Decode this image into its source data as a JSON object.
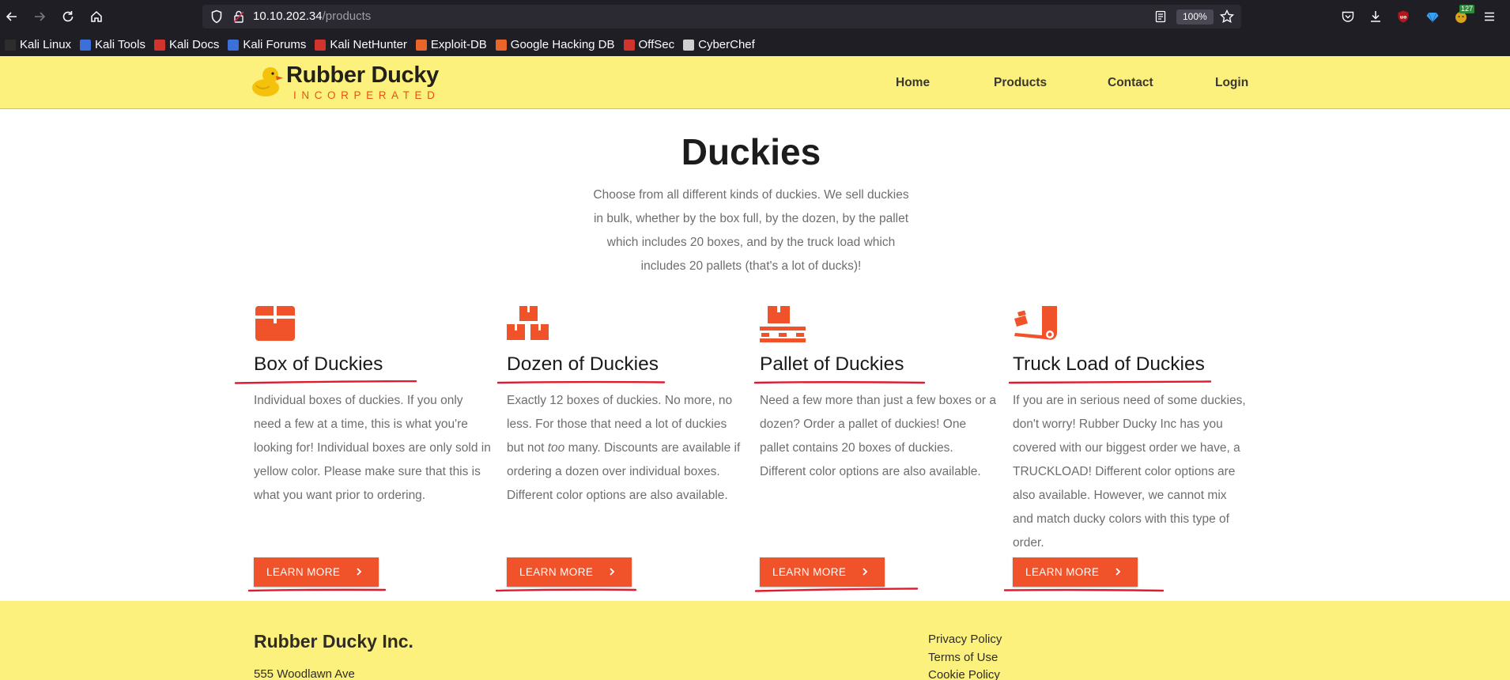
{
  "browser": {
    "url_host": "10.10.202.34",
    "url_path": "/products",
    "zoom": "100%",
    "extension_badge": "127",
    "bookmarks": [
      {
        "label": "Kali Linux",
        "color": "#2d2d2d"
      },
      {
        "label": "Kali Tools",
        "color": "#3b6fd9"
      },
      {
        "label": "Kali Docs",
        "color": "#d0342c"
      },
      {
        "label": "Kali Forums",
        "color": "#3b6fd9"
      },
      {
        "label": "Kali NetHunter",
        "color": "#d0342c"
      },
      {
        "label": "Exploit-DB",
        "color": "#e8662a"
      },
      {
        "label": "Google Hacking DB",
        "color": "#e8662a"
      },
      {
        "label": "OffSec",
        "color": "#d0342c"
      },
      {
        "label": "CyberChef",
        "color": "#cfcfcf"
      }
    ]
  },
  "site": {
    "brand_name": "Rubber Ducky",
    "brand_sub": "INCORPERATED",
    "nav": [
      "Home",
      "Products",
      "Contact",
      "Login"
    ],
    "accent": "#f0522a",
    "header_bg": "#fdf17d"
  },
  "main": {
    "title": "Duckies",
    "intro": "Choose from all different kinds of duckies. We sell duckies in bulk, whether by the box full, by the dozen, by the pallet which includes 20 boxes, and by the truck load which includes 20 pallets (that's a lot of ducks)!",
    "products": [
      {
        "icon": "box-icon",
        "title": "Box of Duckies",
        "desc": "Individual boxes of duckies. If you only need a few at a time, this is what you're looking for! Individual boxes are only sold in yellow color. Please make sure that this is what you want prior to ordering.",
        "button": "LEARN MORE"
      },
      {
        "icon": "boxes-stack-icon",
        "title": "Dozen of Duckies",
        "desc_before": "Exactly 12 boxes of duckies. No more, no less. For those that need a lot of duckies but not ",
        "desc_em": "too",
        "desc_after": " many. Discounts are available if ordering a dozen over individual boxes. Different color options are also available.",
        "button": "LEARN MORE"
      },
      {
        "icon": "pallet-icon",
        "title": "Pallet of Duckies",
        "desc": "Need a few more than just a few boxes or a dozen? Order a pallet of duckies! One pallet contains 20 boxes of duckies. Different color options are also available.",
        "button": "LEARN MORE"
      },
      {
        "icon": "hand-truck-icon",
        "title": "Truck Load of Duckies",
        "desc": "If you are in serious need of some duckies, don't worry! Rubber Ducky Inc has you covered with our biggest order we have, a TRUCKLOAD! Different color options are also available. However, we cannot mix and match ducky colors with this type of order.",
        "button": "LEARN MORE"
      }
    ]
  },
  "footer": {
    "company": "Rubber Ducky Inc.",
    "address": "555 Woodlawn Ave",
    "links": [
      "Privacy Policy",
      "Terms of Use",
      "Cookie Policy"
    ]
  }
}
